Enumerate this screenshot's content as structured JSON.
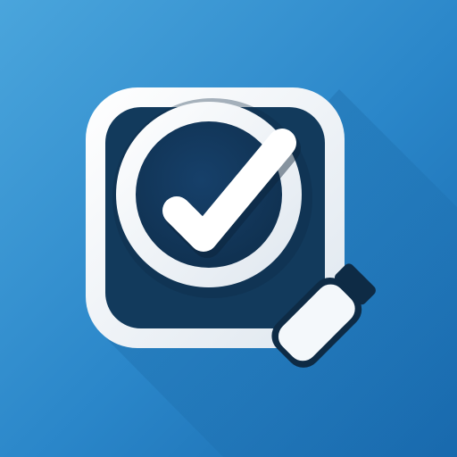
{
  "icon": {
    "semantic": "verified-search-icon",
    "symbol": "checkmark-in-magnifying-glass",
    "frame": "rounded-square"
  },
  "colors": {
    "background_light": "#4aa5dc",
    "background_mid": "#2a86c9",
    "background_dark": "#1869ad",
    "frame_white": "#ffffff",
    "frame_shade": "#dfe7ef",
    "tile_navy": "#123a5c",
    "lens_navy": "#0f2f4d",
    "shadow": "#0d4f86",
    "handle_outline": "#0e2b45"
  }
}
